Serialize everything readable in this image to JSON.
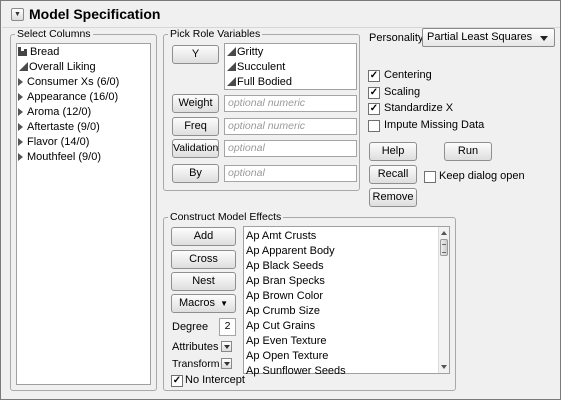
{
  "window": {
    "title": "Model Specification"
  },
  "select_columns": {
    "legend": "Select Columns",
    "items": [
      {
        "label": "Bread",
        "kind": "bar"
      },
      {
        "label": "Overall Liking",
        "kind": "triangle"
      },
      {
        "label": "Consumer Xs (6/0)",
        "kind": "group"
      },
      {
        "label": "Appearance (16/0)",
        "kind": "group"
      },
      {
        "label": "Aroma (12/0)",
        "kind": "group"
      },
      {
        "label": "Aftertaste (9/0)",
        "kind": "group"
      },
      {
        "label": "Flavor (14/0)",
        "kind": "group"
      },
      {
        "label": "Mouthfeel (9/0)",
        "kind": "group"
      }
    ]
  },
  "roles": {
    "legend": "Pick Role Variables",
    "y_label": "Y",
    "y_items": [
      "Gritty",
      "Succulent",
      "Full Bodied"
    ],
    "weight_label": "Weight",
    "weight_placeholder": "optional numeric",
    "freq_label": "Freq",
    "freq_placeholder": "optional numeric",
    "validation_label": "Validation",
    "validation_placeholder": "optional",
    "by_label": "By",
    "by_placeholder": "optional"
  },
  "options": {
    "personality_label": "Personality:",
    "personality_value": "Partial Least Squares",
    "checkboxes": [
      {
        "label": "Centering",
        "checked": true
      },
      {
        "label": "Scaling",
        "checked": true
      },
      {
        "label": "Standardize X",
        "checked": true
      },
      {
        "label": "Impute Missing Data",
        "checked": false
      }
    ],
    "help_label": "Help",
    "run_label": "Run",
    "recall_label": "Recall",
    "keep_open_label": "Keep dialog open",
    "keep_open_checked": false,
    "remove_label": "Remove"
  },
  "effects": {
    "legend": "Construct Model Effects",
    "add_label": "Add",
    "cross_label": "Cross",
    "nest_label": "Nest",
    "macros_label": "Macros",
    "degree_label": "Degree",
    "degree_value": "2",
    "attributes_label": "Attributes",
    "transform_label": "Transform",
    "no_intercept_label": "No Intercept",
    "no_intercept_checked": true,
    "items": [
      "Ap Amt Crusts",
      "Ap Apparent Body",
      "Ap Black Seeds",
      "Ap Bran Specks",
      "Ap Brown Color",
      "Ap Crumb Size",
      "Ap Cut Grains",
      "Ap Even Texture",
      "Ap Open Texture",
      "Ap Sunflower Seeds"
    ]
  }
}
